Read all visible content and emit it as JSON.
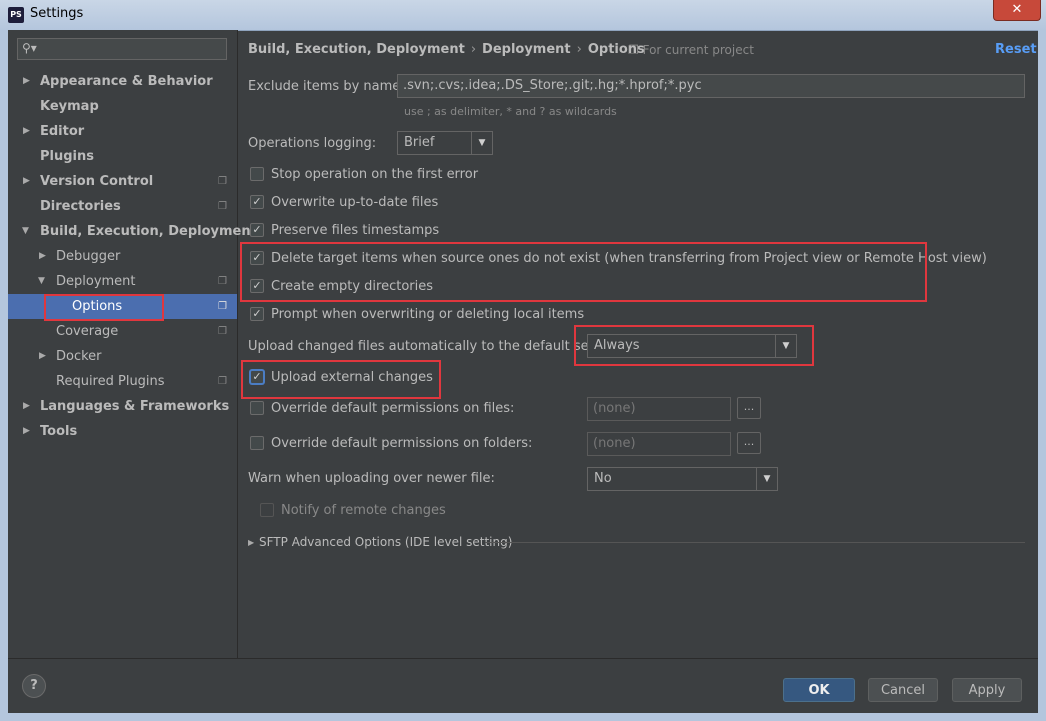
{
  "window": {
    "title": "Settings",
    "app_icon_text": "PS",
    "close_glyph": "✕"
  },
  "sidebar": {
    "search_placeholder": "",
    "items": [
      {
        "label": "Appearance & Behavior",
        "bold": true,
        "arrow": "▶"
      },
      {
        "label": "Keymap",
        "bold": true
      },
      {
        "label": "Editor",
        "bold": true,
        "arrow": "▶"
      },
      {
        "label": "Plugins",
        "bold": true
      },
      {
        "label": "Version Control",
        "bold": true,
        "arrow": "▶"
      },
      {
        "label": "Directories",
        "bold": true
      },
      {
        "label": "Build, Execution, Deployment",
        "bold": true,
        "arrow": "▼"
      },
      {
        "label": "Debugger",
        "arrow": "▶"
      },
      {
        "label": "Deployment",
        "arrow": "▼"
      },
      {
        "label": "Options"
      },
      {
        "label": "Coverage"
      },
      {
        "label": "Docker",
        "arrow": "▶"
      },
      {
        "label": "Required Plugins"
      },
      {
        "label": "Languages & Frameworks",
        "bold": true,
        "arrow": "▶"
      },
      {
        "label": "Tools",
        "bold": true,
        "arrow": "▶"
      }
    ]
  },
  "header": {
    "crumb1": "Build, Execution, Deployment",
    "crumb2": "Deployment",
    "crumb3": "Options",
    "separator": "›",
    "for_project": "For current project",
    "reset": "Reset"
  },
  "form": {
    "exclude_label": "Exclude items by name:",
    "exclude_value": ".svn;.cvs;.idea;.DS_Store;.git;.hg;*.hprof;*.pyc",
    "exclude_hint": "use ; as delimiter, * and ? as wildcards",
    "ops_logging_label": "Operations logging:",
    "ops_logging_value": "Brief",
    "stop_on_error": "Stop operation on the first error",
    "overwrite_uptodate": "Overwrite up-to-date files",
    "preserve_timestamps": "Preserve files timestamps",
    "delete_target": "Delete target items when source ones do not exist (when transferring from Project view or Remote Host view)",
    "create_empty_dirs": "Create empty directories",
    "prompt_overwrite": "Prompt when overwriting or deleting local items",
    "upload_auto_label": "Upload changed files automatically to the default server",
    "upload_auto_value": "Always",
    "upload_external": "Upload external changes",
    "override_files_label": "Override default permissions on files:",
    "override_files_value": "(none)",
    "override_folders_label": "Override default permissions on folders:",
    "override_folders_value": "(none)",
    "warn_newer_label": "Warn when uploading over newer file:",
    "warn_newer_value": "No",
    "notify_remote": "Notify of remote changes",
    "sftp_advanced": "SFTP Advanced Options (IDE level setting)",
    "ellipsis": "..."
  },
  "buttons": {
    "ok": "OK",
    "cancel": "Cancel",
    "apply": "Apply",
    "help": "?"
  },
  "colors": {
    "accent": "#4b6eaf",
    "highlight": "#e0373e",
    "link": "#589df6"
  }
}
